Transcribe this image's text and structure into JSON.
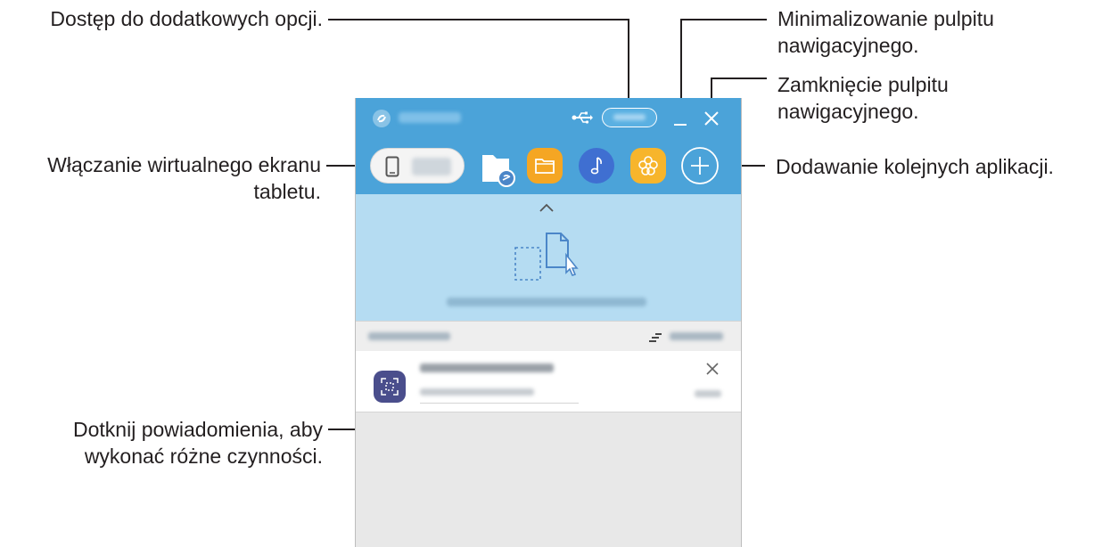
{
  "callouts": {
    "more_options": "Dostęp do dodatkowych opcji.",
    "minimize_line1": "Minimalizowanie pulpitu",
    "minimize_line2": "nawigacyjnego.",
    "close_line1": "Zamknięcie pulpitu",
    "close_line2": "nawigacyjnego.",
    "tablet_line1": "Włączanie wirtualnego ekranu",
    "tablet_line2": "tabletu.",
    "add_apps": "Dodawanie kolejnych aplikacji.",
    "notif_line1": "Dotknij powiadomienia, aby",
    "notif_line2": "wykonać różne czynności."
  },
  "colors": {
    "header_blue": "#4ba3d9",
    "dropzone_blue": "#b5dcf2",
    "folder_orange": "#f5a623",
    "music_blue": "#3f6fd1",
    "gallery_yellow": "#f7b52c",
    "notif_icon": "#4a4e8c"
  },
  "icons": {
    "app_logo": "flow-logo-icon",
    "usb": "usb-icon",
    "minimize": "minimize-icon",
    "close": "close-icon",
    "phone": "phone-icon",
    "shared_folder": "shared-folder-icon",
    "my_files": "folder-icon",
    "music": "music-note-icon",
    "gallery": "flower-icon",
    "add": "plus-icon",
    "collapse": "chevron-up-icon",
    "drop": "file-drop-icon",
    "sort": "sort-icon",
    "screenshot": "screenshot-icon",
    "dismiss": "close-icon"
  }
}
